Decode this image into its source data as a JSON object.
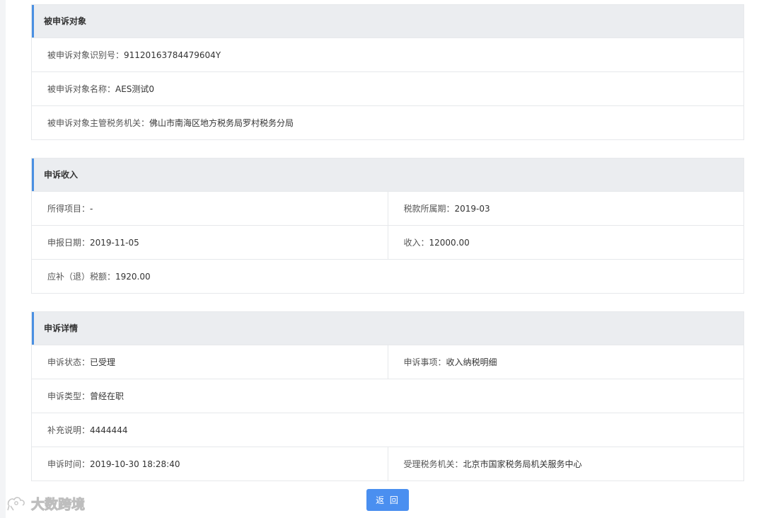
{
  "sections": {
    "target": {
      "title": "被申诉对象",
      "rows": [
        {
          "label": "被申诉对象识别号：",
          "value": "91120163784479604Y"
        },
        {
          "label": "被申诉对象名称：",
          "value": "AES测试0"
        },
        {
          "label": "被申诉对象主管税务机关：",
          "value": "佛山市南海区地方税务局罗村税务分局"
        }
      ]
    },
    "income": {
      "title": "申诉收入",
      "income_item": {
        "label": "所得项目：",
        "value": "-"
      },
      "tax_period": {
        "label": "税款所属期：",
        "value": "2019-03"
      },
      "report_date": {
        "label": "申报日期：",
        "value": "2019-11-05"
      },
      "income_amount": {
        "label": "收入：",
        "value": "12000.00"
      },
      "tax_due": {
        "label": "应补（退）税额：",
        "value": "1920.00"
      }
    },
    "details": {
      "title": "申诉详情",
      "status": {
        "label": "申诉状态：",
        "value": "已受理"
      },
      "matter": {
        "label": "申诉事项：",
        "value": "收入纳税明细"
      },
      "type": {
        "label": "申诉类型：",
        "value": "曾经在职"
      },
      "note": {
        "label": "补充说明：",
        "value": "4444444"
      },
      "time": {
        "label": "申诉时间：",
        "value": "2019-10-30 18:28:40"
      },
      "office": {
        "label": "受理税务机关：",
        "value": "北京市国家税务局机关服务中心"
      }
    }
  },
  "footer": {
    "back_label": "返 回",
    "watermark_text": "大数跨境"
  },
  "colors": {
    "accent": "#4a90e2",
    "header_bg": "#ebedf0",
    "border": "#e6e8eb",
    "button": "#4a8ff0"
  }
}
